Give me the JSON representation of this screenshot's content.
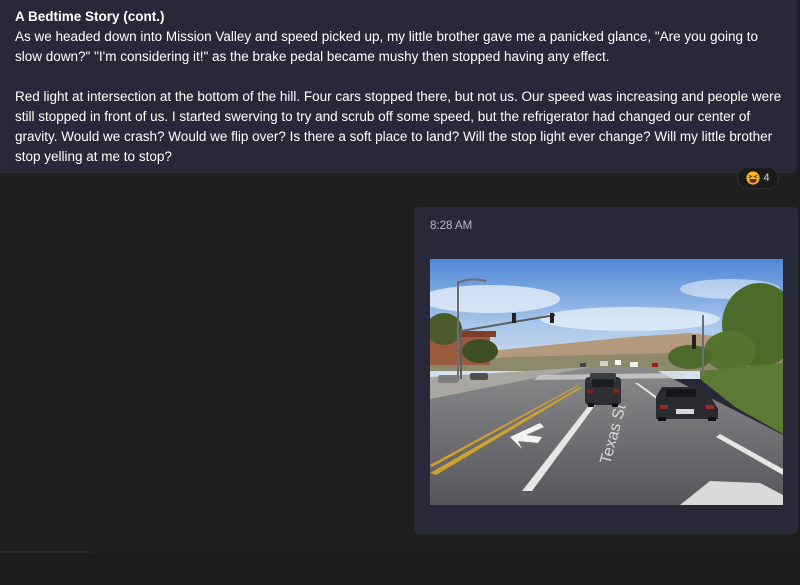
{
  "message_top": {
    "title": "A Bedtime Story (cont.)",
    "paragraph_1": "As we headed down into Mission Valley and speed picked up, my little brother gave me a panicked glance, \"Are you going to slow down?\" \"I'm considering it!\" as the brake pedal became mushy then stopped having any effect.",
    "paragraph_2": "Red light at intersection at the bottom of the hill. Four cars stopped there, but not us. Our speed was increasing and people were still stopped in front of us. I started swerving to try and scrub off some speed, but the refrigerator had changed our center of gravity. Would we crash? Would we flip over? Is there a soft place to land? Will the stop light ever change? Will my little brother stop yelling at me to stop?"
  },
  "reaction": {
    "emoji": "grinning-squinting-face-icon",
    "count": "4"
  },
  "message_image": {
    "time": "8:28 AM",
    "image_icon": "street-photo",
    "street_sign_text": "Texas St"
  },
  "colors": {
    "background": "#1f1f1f",
    "bubble": "#292838",
    "text": "#ffffff",
    "muted_text": "#b9b9c4"
  }
}
